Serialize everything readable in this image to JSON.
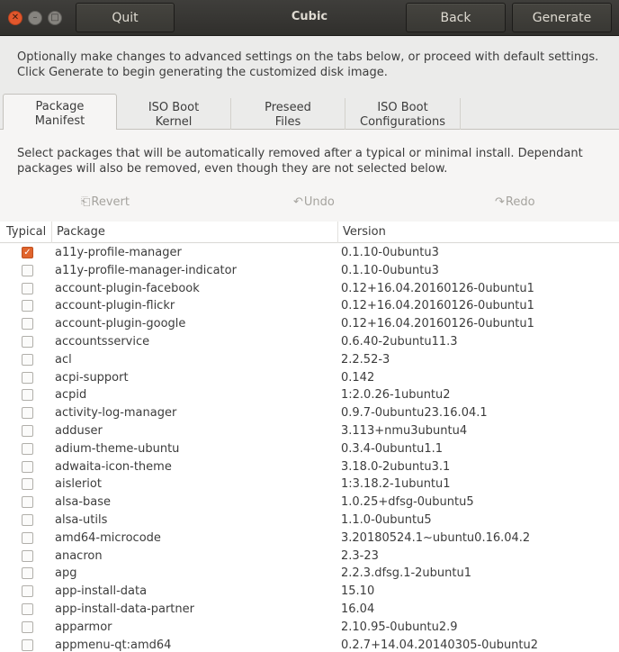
{
  "window": {
    "title": "Cubic",
    "close_glyph": "✕",
    "min_glyph": "–",
    "max_glyph": "□"
  },
  "header": {
    "quit_label": "Quit",
    "back_label": "Back",
    "generate_label": "Generate"
  },
  "intro": {
    "line1": "Optionally make changes to advanced settings on the tabs below, or proceed with default settings.",
    "line2": "Click Generate to begin generating the customized disk image."
  },
  "tabs": [
    {
      "line1": "Package",
      "line2": "Manifest"
    },
    {
      "line1": "ISO Boot",
      "line2": "Kernel"
    },
    {
      "line1": "Preseed",
      "line2": "Files"
    },
    {
      "line1": "ISO Boot",
      "line2": "Configurations"
    }
  ],
  "panel": {
    "desc_line1": "Select packages that will be automatically removed after a typical or minimal install. Dependant",
    "desc_line2": "packages will also be removed, even though they are not selected below.",
    "revert_label": "Revert",
    "undo_label": "Undo",
    "redo_label": "Redo",
    "revert_icon": "⎗",
    "undo_icon": "↶",
    "redo_icon": "↷"
  },
  "table": {
    "columns": [
      "Typical",
      "Package",
      "Version"
    ],
    "check_glyph": "✓",
    "rows": [
      {
        "checked": true,
        "package": "a11y-profile-manager",
        "version": "0.1.10-0ubuntu3"
      },
      {
        "checked": false,
        "package": "a11y-profile-manager-indicator",
        "version": "0.1.10-0ubuntu3"
      },
      {
        "checked": false,
        "package": "account-plugin-facebook",
        "version": "0.12+16.04.20160126-0ubuntu1"
      },
      {
        "checked": false,
        "package": "account-plugin-flickr",
        "version": "0.12+16.04.20160126-0ubuntu1"
      },
      {
        "checked": false,
        "package": "account-plugin-google",
        "version": "0.12+16.04.20160126-0ubuntu1"
      },
      {
        "checked": false,
        "package": "accountsservice",
        "version": "0.6.40-2ubuntu11.3"
      },
      {
        "checked": false,
        "package": "acl",
        "version": "2.2.52-3"
      },
      {
        "checked": false,
        "package": "acpi-support",
        "version": "0.142"
      },
      {
        "checked": false,
        "package": "acpid",
        "version": "1:2.0.26-1ubuntu2"
      },
      {
        "checked": false,
        "package": "activity-log-manager",
        "version": "0.9.7-0ubuntu23.16.04.1"
      },
      {
        "checked": false,
        "package": "adduser",
        "version": "3.113+nmu3ubuntu4"
      },
      {
        "checked": false,
        "package": "adium-theme-ubuntu",
        "version": "0.3.4-0ubuntu1.1"
      },
      {
        "checked": false,
        "package": "adwaita-icon-theme",
        "version": "3.18.0-2ubuntu3.1"
      },
      {
        "checked": false,
        "package": "aisleriot",
        "version": "1:3.18.2-1ubuntu1"
      },
      {
        "checked": false,
        "package": "alsa-base",
        "version": "1.0.25+dfsg-0ubuntu5"
      },
      {
        "checked": false,
        "package": "alsa-utils",
        "version": "1.1.0-0ubuntu5"
      },
      {
        "checked": false,
        "package": "amd64-microcode",
        "version": "3.20180524.1~ubuntu0.16.04.2"
      },
      {
        "checked": false,
        "package": "anacron",
        "version": "2.3-23"
      },
      {
        "checked": false,
        "package": "apg",
        "version": "2.2.3.dfsg.1-2ubuntu1"
      },
      {
        "checked": false,
        "package": "app-install-data",
        "version": "15.10"
      },
      {
        "checked": false,
        "package": "app-install-data-partner",
        "version": "16.04"
      },
      {
        "checked": false,
        "package": "apparmor",
        "version": "2.10.95-0ubuntu2.9"
      },
      {
        "checked": false,
        "package": "appmenu-qt:amd64",
        "version": "0.2.7+14.04.20140305-0ubuntu2"
      }
    ]
  }
}
